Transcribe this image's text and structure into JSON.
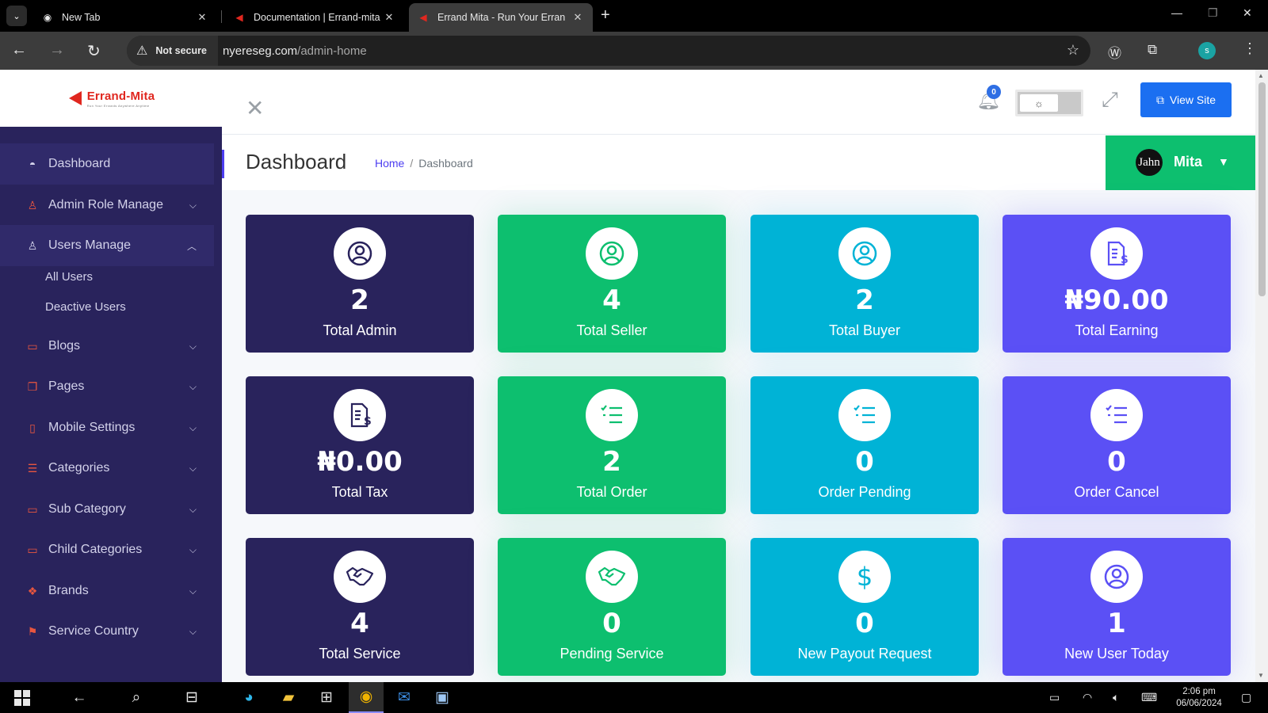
{
  "browser": {
    "tabs": [
      {
        "title": "New Tab",
        "icon": "chrome-icon",
        "active": false
      },
      {
        "title": "Documentation | Errand-mita",
        "icon": "errand-mita-favicon",
        "active": false
      },
      {
        "title": "Errand Mita - Run Your Erran",
        "icon": "errand-mita-favicon",
        "active": true
      }
    ],
    "security_label": "Not secure",
    "url_host": "nyereseg.com",
    "url_path": "/admin-home",
    "profile_initial": "s"
  },
  "sidebar": {
    "logo_text": "Errand-Mita",
    "logo_tagline": "Run Your Errands Anywhere Anytime",
    "items": [
      {
        "label": "Dashboard",
        "icon": "dashboard-gauge-icon"
      },
      {
        "label": "Admin Role Manage",
        "icon": "user-icon"
      },
      {
        "label": "Users Manage",
        "icon": "user-icon"
      },
      {
        "label": "Blogs",
        "icon": "comment-icon"
      },
      {
        "label": "Pages",
        "icon": "pages-icon"
      },
      {
        "label": "Mobile Settings",
        "icon": "mobile-icon"
      },
      {
        "label": "Categories",
        "icon": "list-icon"
      },
      {
        "label": "Sub Category",
        "icon": "sub-category-icon"
      },
      {
        "label": "Child Categories",
        "icon": "sub-category-icon"
      },
      {
        "label": "Brands",
        "icon": "brands-icon"
      },
      {
        "label": "Service Country",
        "icon": "flag-icon"
      }
    ],
    "sub_items": [
      "All Users",
      "Deactive Users"
    ]
  },
  "topbar": {
    "notification_count": "0",
    "view_site_label": "View Site"
  },
  "page": {
    "title": "Dashboard",
    "breadcrumb_home": "Home",
    "breadcrumb_sep": "/",
    "breadcrumb_current": "Dashboard",
    "user_avatar_text": "Jahn",
    "user_name": "Mita"
  },
  "cards": [
    {
      "value": "2",
      "label": "Total Admin",
      "icon": "user-circle-icon",
      "color": "#29235c"
    },
    {
      "value": "4",
      "label": "Total Seller",
      "icon": "user-circle-icon",
      "color": "#0dbf6f"
    },
    {
      "value": "2",
      "label": "Total Buyer",
      "icon": "user-circle-icon",
      "color": "#00b3d6"
    },
    {
      "value": "₦90.00",
      "label": "Total Earning",
      "icon": "invoice-dollar-icon",
      "color": "#5b50f5"
    },
    {
      "value": "₦0.00",
      "label": "Total Tax",
      "icon": "invoice-dollar-icon",
      "color": "#29235c"
    },
    {
      "value": "2",
      "label": "Total Order",
      "icon": "checklist-icon",
      "color": "#0dbf6f"
    },
    {
      "value": "0",
      "label": "Order Pending",
      "icon": "checklist-icon",
      "color": "#00b3d6"
    },
    {
      "value": "0",
      "label": "Order Cancel",
      "icon": "checklist-icon",
      "color": "#5b50f5"
    },
    {
      "value": "4",
      "label": "Total Service",
      "icon": "handshake-icon",
      "color": "#29235c"
    },
    {
      "value": "0",
      "label": "Pending Service",
      "icon": "handshake-icon",
      "color": "#0dbf6f"
    },
    {
      "value": "0",
      "label": "New Payout Request",
      "icon": "dollar-icon",
      "color": "#00b3d6"
    },
    {
      "value": "1",
      "label": "New User Today",
      "icon": "user-circle-icon",
      "color": "#5b50f5"
    }
  ],
  "taskbar": {
    "time": "2:06 pm",
    "date": "06/06/2024"
  }
}
